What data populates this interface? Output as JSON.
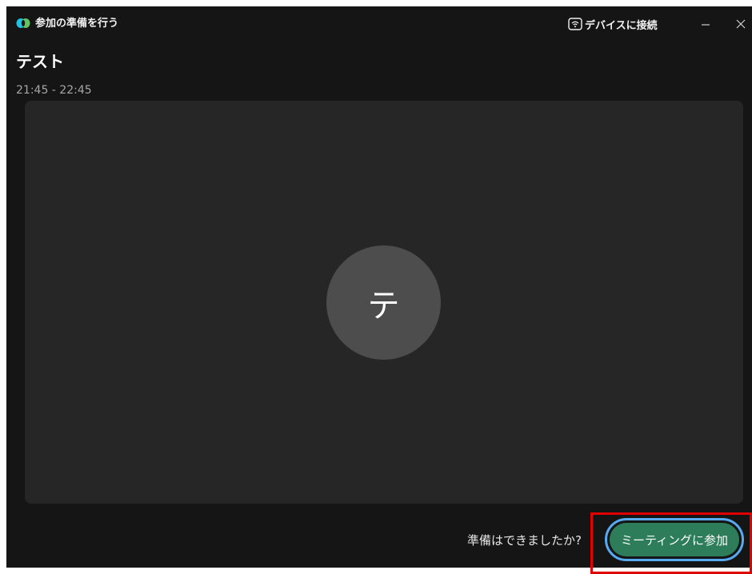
{
  "window": {
    "title": "参加の準備を行う",
    "icons": {
      "app": "webex-logo-icon",
      "device": "cast-device-icon",
      "minimize": "minimize-icon",
      "close": "close-icon"
    }
  },
  "toolbar": {
    "device_label": "デバイスに接続"
  },
  "meeting": {
    "title": "テスト",
    "time": "21:45 - 22:45"
  },
  "preview": {
    "avatar_initial": "テ"
  },
  "footer": {
    "ready_text": "準備はできましたか?",
    "join_label": "ミーティングに参加"
  },
  "colors": {
    "background": "#151515",
    "panel": "#262626",
    "avatar": "#4d4d4d",
    "join_button": "#2d7d5b",
    "focus_ring": "#58aaf0",
    "highlight": "#e00000"
  }
}
